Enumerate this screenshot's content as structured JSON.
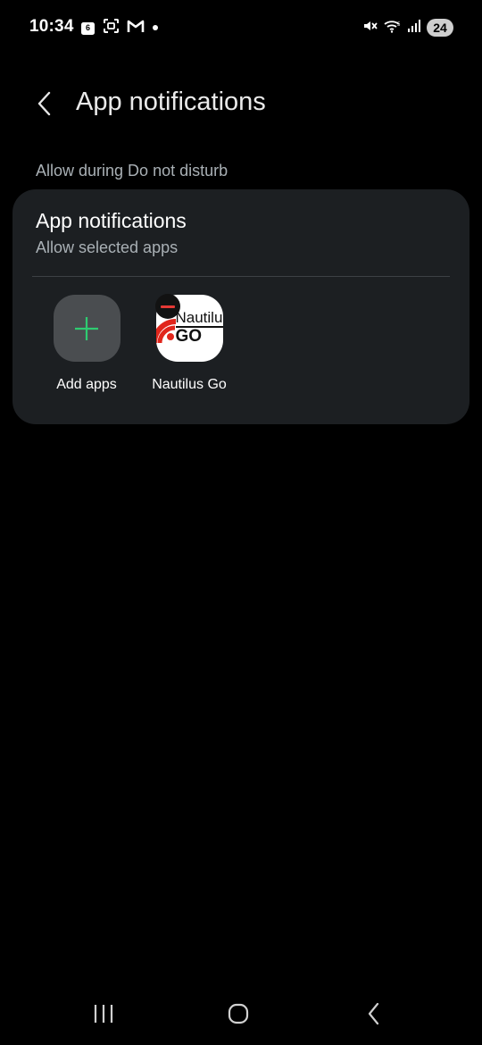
{
  "status_bar": {
    "time": "10:34",
    "calendar_badge": "6",
    "battery_level": "24",
    "left_icons": [
      "calendar-icon",
      "screenshot-icon",
      "gmail-icon",
      "dot-icon"
    ],
    "right_icons": [
      "mute-icon",
      "wifi-icon",
      "signal-icon",
      "battery-icon"
    ]
  },
  "header": {
    "title": "App notifications"
  },
  "section": {
    "label": "Allow during Do not disturb"
  },
  "card": {
    "title": "App notifications",
    "subtitle": "Allow selected apps",
    "apps": [
      {
        "label": "Add apps",
        "icon": "plus-icon",
        "accent": "#2ecc71"
      },
      {
        "label": "Nautilus Go",
        "icon": "nautilus-go-app-icon",
        "logo_text_top": "Nautilu",
        "logo_text_bottom": "GO",
        "accent": "#e1261c"
      }
    ]
  },
  "colors": {
    "background": "#000000",
    "card": "#1c1f22",
    "secondary_text": "#a9b0b5",
    "add_tile": "#4a4d50",
    "remove_badge": "#e53935"
  },
  "nav_bar": {
    "buttons": [
      "recents-icon",
      "home-icon",
      "back-icon"
    ]
  }
}
